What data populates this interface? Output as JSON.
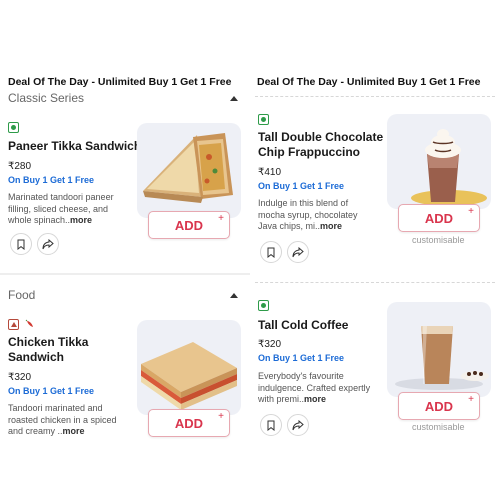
{
  "left": {
    "deal_header": "Deal Of The Day - Unlimited Buy 1 Get 1 Free",
    "sections": [
      {
        "title": "Classic Series",
        "items": [
          {
            "name_lines": [
              "Paneer Tikka Sandwich"
            ],
            "diet": "veg",
            "price": "₹280",
            "offer": "On Buy 1 Get 1 Free",
            "desc_lines": [
              "Marinated tandoori paneer",
              "filling, sliced cheese, and",
              "whole spinach.."
            ],
            "more": "more",
            "add_label": "ADD",
            "plus": "+"
          }
        ]
      },
      {
        "title": "Food",
        "items": [
          {
            "name_lines": [
              "Chicken Tikka",
              "Sandwich"
            ],
            "diet": "non-veg",
            "spicy": true,
            "price": "₹320",
            "offer": "On Buy 1 Get 1 Free",
            "desc_lines": [
              "Tandoori marinated and",
              "roasted chicken in a spiced",
              "and creamy .."
            ],
            "more": "more",
            "add_label": "ADD",
            "plus": "+"
          }
        ]
      }
    ]
  },
  "right": {
    "deal_header": "Deal Of The Day - Unlimited Buy 1 Get 1 Free",
    "items": [
      {
        "name_lines": [
          "Tall Double Chocolate",
          "Chip Frappuccino"
        ],
        "diet": "veg",
        "price": "₹410",
        "offer": "On Buy 1 Get 1 Free",
        "desc_lines": [
          "Indulge in this blend of",
          "mocha syrup, chocolatey",
          "Java chips, mi.."
        ],
        "more": "more",
        "add_label": "ADD",
        "plus": "+",
        "customisable": "customisable"
      },
      {
        "name_lines": [
          "Tall Cold Coffee"
        ],
        "diet": "veg",
        "price": "₹320",
        "offer": "On Buy 1 Get 1 Free",
        "desc_lines": [
          "Everybody's favourite",
          "indulgence. Crafted expertly",
          "with premi.."
        ],
        "more": "more",
        "add_label": "ADD",
        "plus": "+",
        "customisable": "customisable"
      }
    ]
  },
  "colors": {
    "veg": "#2e9b49",
    "non_veg": "#b5493b",
    "offer_blue": "#1c6bd6",
    "add_red": "#d9354d"
  },
  "icons": [
    "bookmark-icon",
    "share-icon",
    "caret-up-icon",
    "spicy-chili-icon"
  ]
}
